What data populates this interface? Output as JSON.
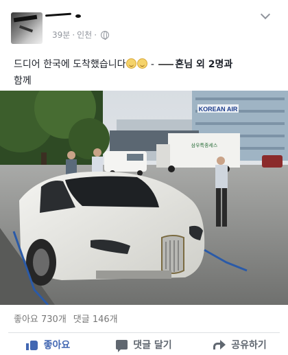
{
  "post": {
    "meta": {
      "time": "39분",
      "separator": "·",
      "location": "인천"
    },
    "text_line1": "드디어 한국에 도착했습니다",
    "text_dash": " - ",
    "text_tag_suffix": "혼님 외 2명과",
    "text_line2": "함께",
    "photo": {
      "sign_text": "KOREAN AIR",
      "truck_text": "삼우특종세스"
    },
    "counts": {
      "likes": "좋아요 730개",
      "comments": "댓글 146개"
    },
    "actions": {
      "like": "좋아요",
      "comment": "댓글 달기",
      "share": "공유하기"
    }
  },
  "icons": {
    "privacy": "globe-icon",
    "options": "chevron-down-icon",
    "like": "like-icon",
    "comment": "comment-icon",
    "share": "share-icon"
  },
  "colors": {
    "like_accent": "#4267b2",
    "meta_text": "#90949c"
  }
}
